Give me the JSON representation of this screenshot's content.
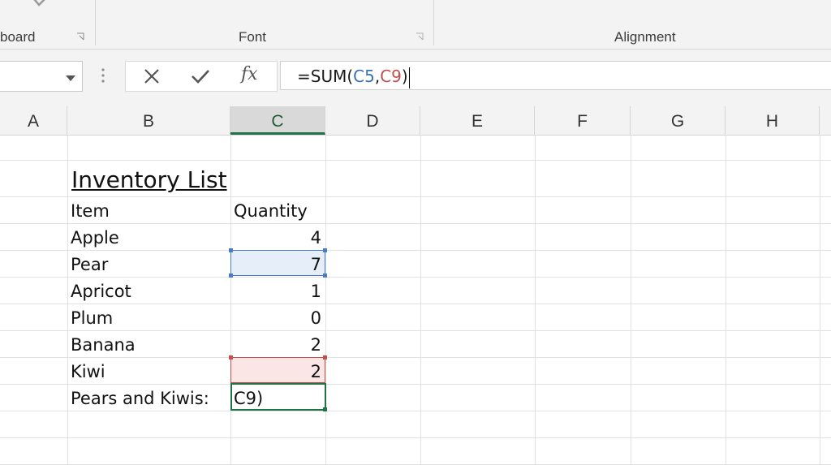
{
  "ribbon": {
    "groups": [
      {
        "label": "board"
      },
      {
        "label": "Font"
      },
      {
        "label": "Alignment"
      }
    ]
  },
  "formula_bar": {
    "name_box_value": "",
    "fx_label": "fx",
    "formula_prefix": "=SUM(",
    "ref1": "C5",
    "comma": ",",
    "ref2": "C9",
    "formula_suffix": ")"
  },
  "columns": [
    "A",
    "B",
    "C",
    "D",
    "E",
    "F",
    "G",
    "H"
  ],
  "active_column": "C",
  "sheet": {
    "title": "Inventory List",
    "header_item": "Item",
    "header_quantity": "Quantity",
    "rows": [
      {
        "item": "Apple",
        "qty": "4"
      },
      {
        "item": "Pear",
        "qty": "7"
      },
      {
        "item": "Apricot",
        "qty": "1"
      },
      {
        "item": "Plum",
        "qty": "0"
      },
      {
        "item": "Banana",
        "qty": "2"
      },
      {
        "item": "Kiwi",
        "qty": "2"
      }
    ],
    "total_label": "Pears and Kiwis:",
    "editing_cell_text": "C9)"
  },
  "colors": {
    "excel_green": "#217346",
    "ref_blue": "#3a72b8",
    "ref_red": "#c0504d"
  }
}
